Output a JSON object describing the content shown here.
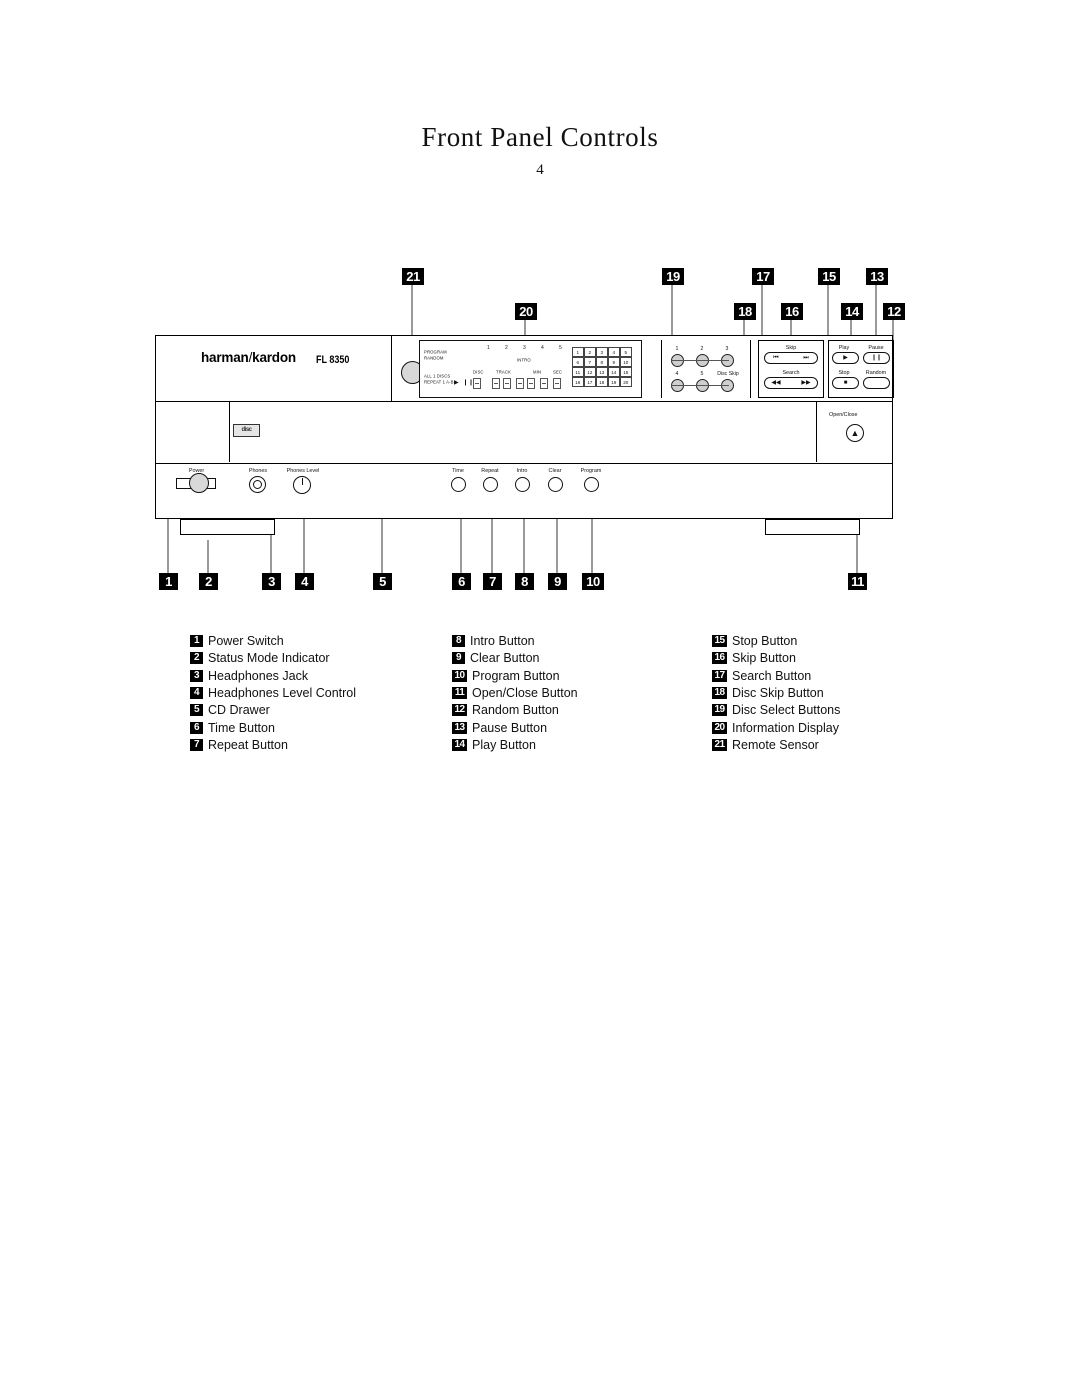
{
  "header": {
    "title": "Front Panel Controls",
    "page_number": "4"
  },
  "device": {
    "brand_left": "harman",
    "brand_slash": "/",
    "brand_right": "kardon",
    "model": "FL 8350",
    "cd_logo": "disc",
    "eject_label": "Open/Close",
    "eject_icon": "▲"
  },
  "display": {
    "program": "PROGRAM",
    "random": "RANDOM",
    "all_discs": "ALL 1 DISCS",
    "repeat": "REPEAT 1 A-B",
    "intro": "INTRO",
    "disc": "DISC",
    "track": "TRACK",
    "min": "MIN",
    "sec": "SEC",
    "play_icon": "▶",
    "pause_icon": "❙❙",
    "disc_indicators": [
      "1",
      "2",
      "3",
      "4",
      "5"
    ],
    "track_numbers": [
      "1",
      "2",
      "3",
      "4",
      "5",
      "6",
      "7",
      "8",
      "9",
      "10",
      "11",
      "12",
      "13",
      "14",
      "15",
      "16",
      "17",
      "18",
      "19",
      "20"
    ]
  },
  "disc_select": {
    "buttons": [
      "1",
      "2",
      "3",
      "4",
      "5"
    ],
    "disc_skip_label": "Disc Skip"
  },
  "transport": {
    "skip_label": "Skip",
    "skip_prev_icon": "⏮",
    "skip_next_icon": "⏭",
    "search_label": "Search",
    "search_back_icon": "◀◀",
    "search_fwd_icon": "▶▶",
    "play_label": "Play",
    "play_icon": "▶",
    "pause_label": "Pause",
    "pause_icon": "❙❙",
    "stop_label": "Stop",
    "stop_icon": "■",
    "random_label": "Random"
  },
  "bottom_controls": {
    "power": "Power",
    "phones": "Phones",
    "phones_level": "Phones Level",
    "time": "Time",
    "repeat": "Repeat",
    "intro": "Intro",
    "clear": "Clear",
    "program": "Program"
  },
  "callouts": {
    "top": [
      "21",
      "20",
      "19",
      "18",
      "17",
      "16",
      "15",
      "14",
      "13",
      "12"
    ],
    "bottom": [
      "1",
      "2",
      "3",
      "4",
      "5",
      "6",
      "7",
      "8",
      "9",
      "10",
      "11"
    ]
  },
  "legend": {
    "column1": [
      {
        "num": "1",
        "label": "Power Switch"
      },
      {
        "num": "2",
        "label": "Status Mode Indicator"
      },
      {
        "num": "3",
        "label": "Headphones Jack"
      },
      {
        "num": "4",
        "label": "Headphones Level Control"
      },
      {
        "num": "5",
        "label": "CD Drawer"
      },
      {
        "num": "6",
        "label": "Time Button"
      },
      {
        "num": "7",
        "label": "Repeat Button"
      }
    ],
    "column2": [
      {
        "num": "8",
        "label": "Intro Button"
      },
      {
        "num": "9",
        "label": "Clear Button"
      },
      {
        "num": "10",
        "label": "Program Button"
      },
      {
        "num": "11",
        "label": "Open/Close Button"
      },
      {
        "num": "12",
        "label": "Random Button"
      },
      {
        "num": "13",
        "label": "Pause Button"
      },
      {
        "num": "14",
        "label": "Play Button"
      }
    ],
    "column3": [
      {
        "num": "15",
        "label": "Stop Button"
      },
      {
        "num": "16",
        "label": "Skip Button"
      },
      {
        "num": "17",
        "label": "Search Button"
      },
      {
        "num": "18",
        "label": "Disc Skip Button"
      },
      {
        "num": "19",
        "label": "Disc Select Buttons"
      },
      {
        "num": "20",
        "label": "Information Display"
      },
      {
        "num": "21",
        "label": "Remote Sensor"
      }
    ]
  }
}
